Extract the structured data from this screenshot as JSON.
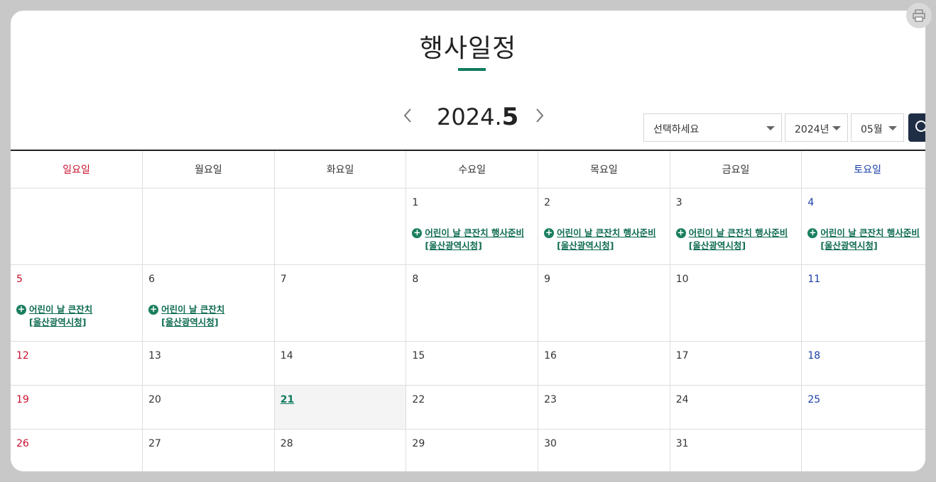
{
  "page": {
    "title": "행사일정",
    "accent_color": "#0f7a5f",
    "print_icon": "print-icon"
  },
  "month_nav": {
    "year": "2024.",
    "month": "5",
    "prev_icon": "chevron-left-icon",
    "next_icon": "chevron-right-icon"
  },
  "filters": {
    "category": "선택하세요",
    "year": "2024년",
    "month": "05월",
    "search_icon": "search-icon"
  },
  "weekdays": [
    "일요일",
    "월요일",
    "화요일",
    "수요일",
    "목요일",
    "금요일",
    "토요일"
  ],
  "weeks": [
    [
      {
        "day": "",
        "events": []
      },
      {
        "day": "",
        "events": []
      },
      {
        "day": "",
        "events": []
      },
      {
        "day": "1",
        "events": [
          "어린이 날 큰잔치 행사준비 [울산광역시청]"
        ]
      },
      {
        "day": "2",
        "events": [
          "어린이 날 큰잔치 행사준비 [울산광역시청]"
        ]
      },
      {
        "day": "3",
        "events": [
          "어린이 날 큰잔치 행사준비 [울산광역시청]"
        ]
      },
      {
        "day": "4",
        "events": [
          "어린이 날 큰잔치 행사준비 [울산광역시청]"
        ]
      }
    ],
    [
      {
        "day": "5",
        "events": [
          "어린이 날 큰잔치 [울산광역시청]"
        ]
      },
      {
        "day": "6",
        "events": [
          "어린이 날 큰잔치 [울산광역시청]"
        ]
      },
      {
        "day": "7",
        "events": []
      },
      {
        "day": "8",
        "events": []
      },
      {
        "day": "9",
        "events": []
      },
      {
        "day": "10",
        "events": []
      },
      {
        "day": "11",
        "events": []
      }
    ],
    [
      {
        "day": "12",
        "events": []
      },
      {
        "day": "13",
        "events": []
      },
      {
        "day": "14",
        "events": []
      },
      {
        "day": "15",
        "events": []
      },
      {
        "day": "16",
        "events": []
      },
      {
        "day": "17",
        "events": []
      },
      {
        "day": "18",
        "events": []
      }
    ],
    [
      {
        "day": "19",
        "events": []
      },
      {
        "day": "20",
        "events": []
      },
      {
        "day": "21",
        "events": [],
        "today": true
      },
      {
        "day": "22",
        "events": []
      },
      {
        "day": "23",
        "events": []
      },
      {
        "day": "24",
        "events": []
      },
      {
        "day": "25",
        "events": []
      }
    ],
    [
      {
        "day": "26",
        "events": []
      },
      {
        "day": "27",
        "events": []
      },
      {
        "day": "28",
        "events": []
      },
      {
        "day": "29",
        "events": []
      },
      {
        "day": "30",
        "events": []
      },
      {
        "day": "31",
        "events": []
      },
      {
        "day": "",
        "events": []
      }
    ]
  ]
}
